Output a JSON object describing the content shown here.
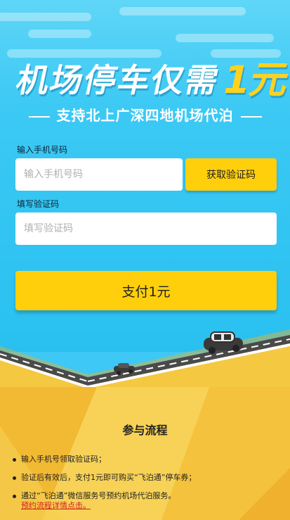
{
  "header": {
    "headline_main": "机场停车仅需",
    "headline_price": "1元",
    "subtitle": "支持北上广深四地机场代泊"
  },
  "form": {
    "phone_label": "输入手机号码",
    "phone_placeholder": "输入手机号码",
    "get_code_label": "获取验证码",
    "code_label": "填写验证码",
    "code_placeholder": "填写验证码",
    "pay_label": "支付1元"
  },
  "process": {
    "title": "参与流程",
    "steps": [
      "输入手机号领取验证码；",
      "验证后有效后，支付1元即可购买“飞泊通”停车券；",
      "通过“飞泊通”微信服务号预约机场代泊服务。"
    ],
    "detail_link": "预约流程详情点击。"
  },
  "colors": {
    "sky": "#3ec8f5",
    "accent_yellow": "#ffcf0c",
    "link_red": "#d41f1f"
  }
}
